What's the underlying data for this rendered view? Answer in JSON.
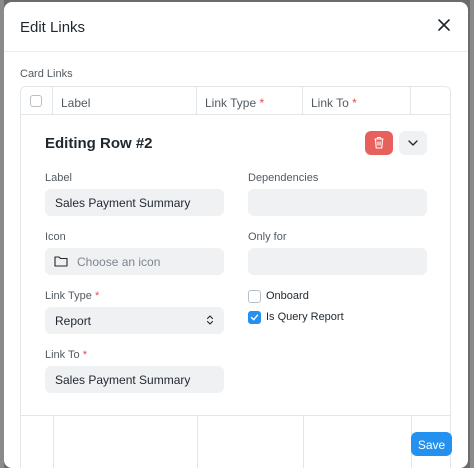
{
  "dialog": {
    "title": "Edit Links",
    "close_icon": "close-icon"
  },
  "card_links": {
    "section_label": "Card Links",
    "columns": [
      {
        "label": "Label",
        "required": false
      },
      {
        "label": "Link Type",
        "required": true
      },
      {
        "label": "Link To",
        "required": true
      }
    ],
    "required_mark": "*"
  },
  "editing_row": {
    "title": "Editing Row #2",
    "delete_icon": "trash-icon",
    "collapse_icon": "chevron-down-icon",
    "label_field": {
      "label": "Label",
      "value": "Sales Payment Summary"
    },
    "dependencies_field": {
      "label": "Dependencies",
      "value": ""
    },
    "icon_field": {
      "label": "Icon",
      "placeholder": "Choose an icon",
      "icon": "folder-icon"
    },
    "only_for_field": {
      "label": "Only for",
      "value": ""
    },
    "link_type_field": {
      "label": "Link Type",
      "value": "Report",
      "required": true
    },
    "link_to_field": {
      "label": "Link To",
      "value": "Sales Payment Summary",
      "required": true
    },
    "onboard_checkbox": {
      "label": "Onboard",
      "checked": false
    },
    "is_query_report_checkbox": {
      "label": "Is Query Report",
      "checked": true
    }
  },
  "footer": {
    "save_label": "Save"
  },
  "colors": {
    "primary": "#2490ef",
    "danger": "#e8605b",
    "field_bg": "#f0f1f3"
  }
}
